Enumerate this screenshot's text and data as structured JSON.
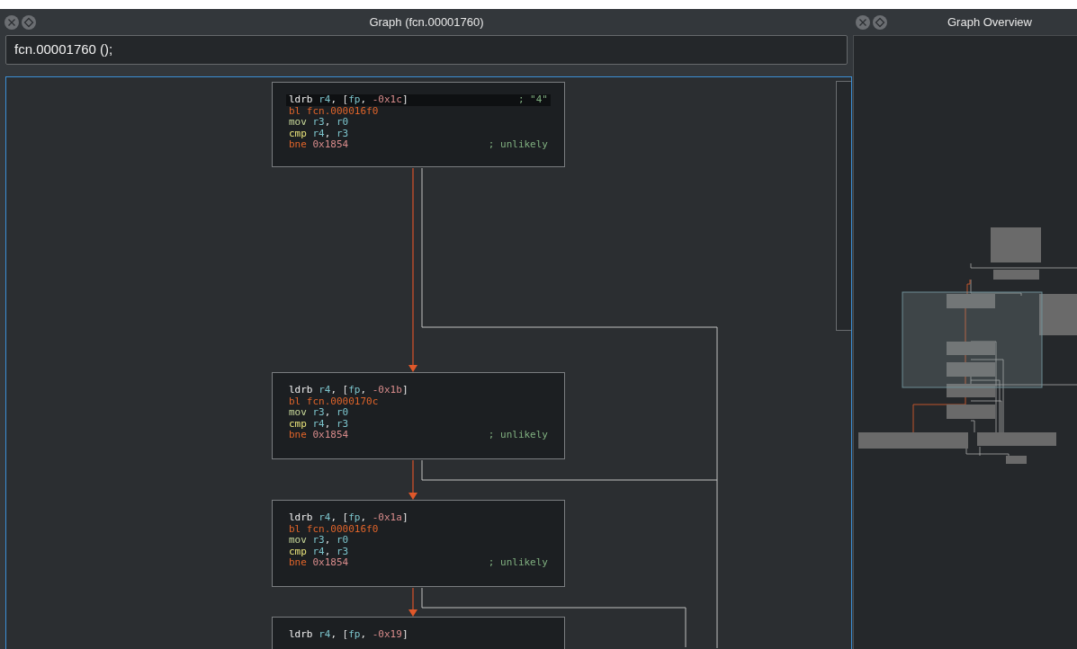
{
  "graph_panel": {
    "title": "Graph (fcn.00001760)",
    "function_field": {
      "value": "fcn.00001760 ();"
    }
  },
  "overview_panel": {
    "title": "Graph Overview"
  },
  "blocks": [
    {
      "lines": [
        {
          "highlighted": true,
          "tokens": [
            {
              "text": "ldrb ",
              "kind": "load"
            },
            {
              "text": "r4",
              "kind": "reg"
            },
            {
              "text": ", [",
              "kind": "punct"
            },
            {
              "text": "fp",
              "kind": "reg"
            },
            {
              "text": ", ",
              "kind": "punct"
            },
            {
              "text": "-0x1c",
              "kind": "imm"
            },
            {
              "text": "]",
              "kind": "punct"
            }
          ],
          "comment": "; \"4\""
        },
        {
          "highlighted": false,
          "tokens": [
            {
              "text": "bl fcn.000016f0",
              "kind": "call"
            }
          ]
        },
        {
          "highlighted": false,
          "tokens": [
            {
              "text": "mov ",
              "kind": "move"
            },
            {
              "text": "r3",
              "kind": "reg"
            },
            {
              "text": ", ",
              "kind": "punct"
            },
            {
              "text": "r0",
              "kind": "reg"
            }
          ]
        },
        {
          "highlighted": false,
          "tokens": [
            {
              "text": "cmp ",
              "kind": "compare"
            },
            {
              "text": "r4",
              "kind": "reg"
            },
            {
              "text": ", ",
              "kind": "punct"
            },
            {
              "text": "r3",
              "kind": "reg"
            }
          ]
        },
        {
          "highlighted": false,
          "tokens": [
            {
              "text": "bne ",
              "kind": "branch"
            },
            {
              "text": "0x1854",
              "kind": "imm"
            }
          ],
          "comment": "; unlikely"
        }
      ]
    },
    {
      "lines": [
        {
          "highlighted": false,
          "tokens": [
            {
              "text": "ldrb ",
              "kind": "load"
            },
            {
              "text": "r4",
              "kind": "reg"
            },
            {
              "text": ", [",
              "kind": "punct"
            },
            {
              "text": "fp",
              "kind": "reg"
            },
            {
              "text": ", ",
              "kind": "punct"
            },
            {
              "text": "-0x1b",
              "kind": "imm"
            },
            {
              "text": "]",
              "kind": "punct"
            }
          ]
        },
        {
          "highlighted": false,
          "tokens": [
            {
              "text": "bl fcn.0000170c",
              "kind": "call"
            }
          ]
        },
        {
          "highlighted": false,
          "tokens": [
            {
              "text": "mov ",
              "kind": "move"
            },
            {
              "text": "r3",
              "kind": "reg"
            },
            {
              "text": ", ",
              "kind": "punct"
            },
            {
              "text": "r0",
              "kind": "reg"
            }
          ]
        },
        {
          "highlighted": false,
          "tokens": [
            {
              "text": "cmp ",
              "kind": "compare"
            },
            {
              "text": "r4",
              "kind": "reg"
            },
            {
              "text": ", ",
              "kind": "punct"
            },
            {
              "text": "r3",
              "kind": "reg"
            }
          ]
        },
        {
          "highlighted": false,
          "tokens": [
            {
              "text": "bne ",
              "kind": "branch"
            },
            {
              "text": "0x1854",
              "kind": "imm"
            }
          ],
          "comment": "; unlikely"
        }
      ]
    },
    {
      "lines": [
        {
          "highlighted": false,
          "tokens": [
            {
              "text": "ldrb ",
              "kind": "load"
            },
            {
              "text": "r4",
              "kind": "reg"
            },
            {
              "text": ", [",
              "kind": "punct"
            },
            {
              "text": "fp",
              "kind": "reg"
            },
            {
              "text": ", ",
              "kind": "punct"
            },
            {
              "text": "-0x1a",
              "kind": "imm"
            },
            {
              "text": "]",
              "kind": "punct"
            }
          ]
        },
        {
          "highlighted": false,
          "tokens": [
            {
              "text": "bl fcn.000016f0",
              "kind": "call"
            }
          ]
        },
        {
          "highlighted": false,
          "tokens": [
            {
              "text": "mov ",
              "kind": "move"
            },
            {
              "text": "r3",
              "kind": "reg"
            },
            {
              "text": ", ",
              "kind": "punct"
            },
            {
              "text": "r0",
              "kind": "reg"
            }
          ]
        },
        {
          "highlighted": false,
          "tokens": [
            {
              "text": "cmp ",
              "kind": "compare"
            },
            {
              "text": "r4",
              "kind": "reg"
            },
            {
              "text": ", ",
              "kind": "punct"
            },
            {
              "text": "r3",
              "kind": "reg"
            }
          ]
        },
        {
          "highlighted": false,
          "tokens": [
            {
              "text": "bne ",
              "kind": "branch"
            },
            {
              "text": "0x1854",
              "kind": "imm"
            }
          ],
          "comment": "; unlikely"
        }
      ]
    },
    {
      "lines": [
        {
          "highlighted": false,
          "tokens": [
            {
              "text": "ldrb ",
              "kind": "load"
            },
            {
              "text": "r4",
              "kind": "reg"
            },
            {
              "text": ", [",
              "kind": "punct"
            },
            {
              "text": "fp",
              "kind": "reg"
            },
            {
              "text": ", ",
              "kind": "punct"
            },
            {
              "text": "-0x19",
              "kind": "imm"
            },
            {
              "text": "]",
              "kind": "punct"
            }
          ]
        }
      ]
    }
  ]
}
